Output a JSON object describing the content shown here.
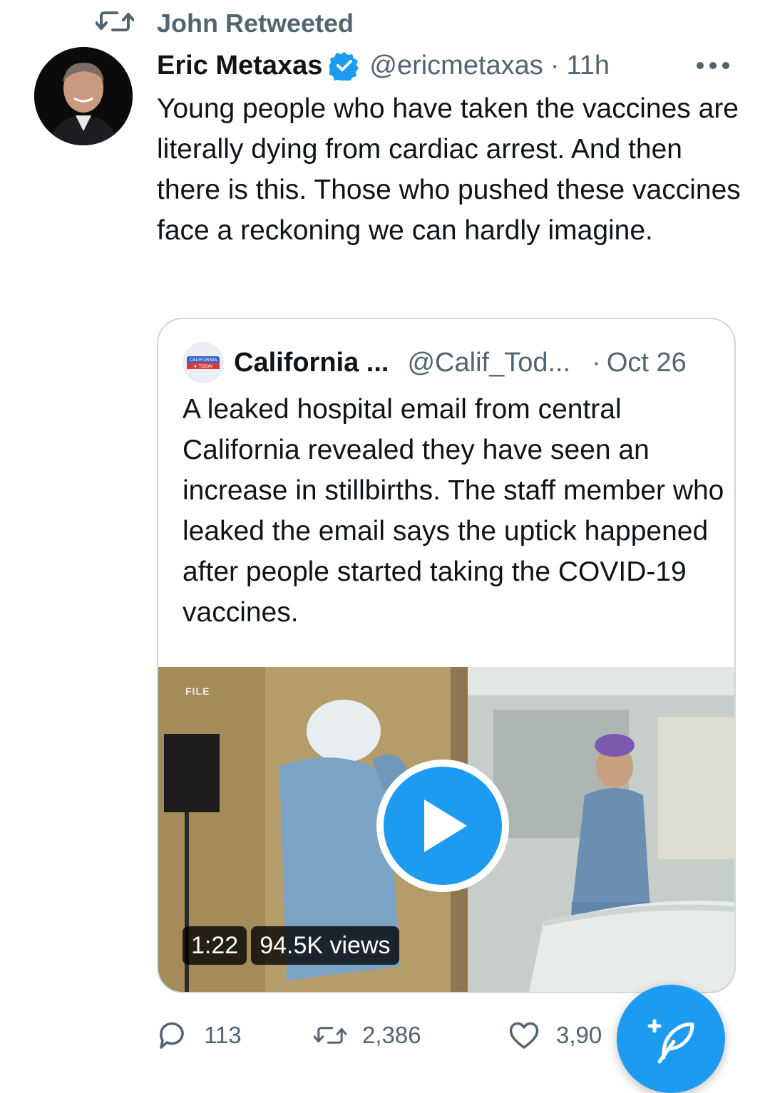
{
  "retweet_header": {
    "label": "John Retweeted",
    "icon": "retweet-icon"
  },
  "tweet": {
    "author_name": "Eric Metaxas",
    "handle": "@ericmetaxas",
    "separator": "·",
    "time": "11h",
    "text": "Young people who have taken the vaccines are literally dying from cardiac arrest. And then there is this. Those who pushed these vaccines face a reckoning we can hardly imagine."
  },
  "quoted_tweet": {
    "author_name": "California ...",
    "handle": "@Calif_Tod...",
    "separator": "·",
    "date": "Oct 26",
    "text": "A leaked hospital email from central California revealed they have seen an increase in stillbirths. The staff member who leaked the email says the uptick happened after people started taking the COVID-19 vaccines.",
    "avatar_text": {
      "line1": "CALIFORNIA",
      "line2": "★ TODAY"
    },
    "video": {
      "overlay_tag": "FILE",
      "duration": "1:22",
      "views": "94.5K views"
    }
  },
  "actions": {
    "replies": "113",
    "retweets": "2,386",
    "likes": "3,90"
  },
  "colors": {
    "accent": "#1d9bf0",
    "text_primary": "#0f1419",
    "text_secondary": "#536471",
    "border": "#cfd9de"
  }
}
